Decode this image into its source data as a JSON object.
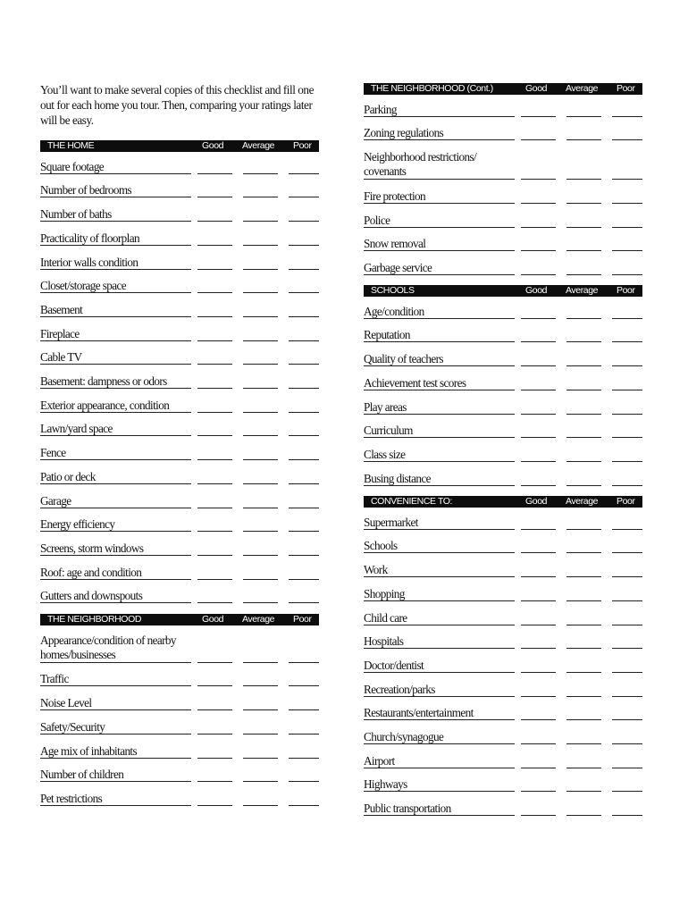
{
  "intro": "You’ll want to make several copies of this checklist and fill one out for each home you tour.  Then, comparing your ratings later will be easy.",
  "rating_columns": [
    "Good",
    "Average",
    "Poor"
  ],
  "sections": {
    "home": {
      "title": "THE HOME",
      "items": [
        "Square footage",
        "Number of bedrooms",
        "Number of baths",
        "Practicality of floorplan",
        "Interior walls condition",
        "Closet/storage space",
        "Basement",
        "Fireplace",
        "Cable TV",
        "Basement: dampness or odors",
        "Exterior appearance, condition",
        "Lawn/yard space",
        "Fence",
        "Patio or deck",
        "Garage",
        "Energy efficiency",
        "Screens, storm windows",
        "Roof: age and condition",
        "Gutters and downspouts"
      ]
    },
    "neighborhood": {
      "title": "THE NEIGHBORHOOD",
      "items": [
        {
          "line1": "Appearance/condition of nearby",
          "line2": "homes/businesses"
        },
        "Traffic",
        "Noise Level",
        "Safety/Security",
        "Age mix of inhabitants",
        "Number of children",
        "Pet restrictions"
      ]
    },
    "neighborhood_cont": {
      "title": "THE NEIGHBORHOOD (Cont.)",
      "items": [
        "Parking",
        "Zoning regulations",
        {
          "line1": "Neighborhood restrictions/",
          "line2": "covenants"
        },
        "Fire protection",
        "Police",
        "Snow removal",
        "Garbage service"
      ]
    },
    "schools": {
      "title": "SCHOOLS",
      "items": [
        "Age/condition",
        "Reputation",
        "Quality of teachers",
        "Achievement test scores",
        "Play areas",
        "Curriculum",
        "Class size",
        "Busing distance"
      ]
    },
    "convenience": {
      "title": "CONVENIENCE TO:",
      "items": [
        "Supermarket",
        "Schools",
        "Work",
        "Shopping",
        "Child care",
        "Hospitals",
        "Doctor/dentist",
        "Recreation/parks",
        "Restaurants/entertainment",
        "Church/synagogue",
        "Airport",
        "Highways",
        "Public transportation"
      ]
    }
  }
}
